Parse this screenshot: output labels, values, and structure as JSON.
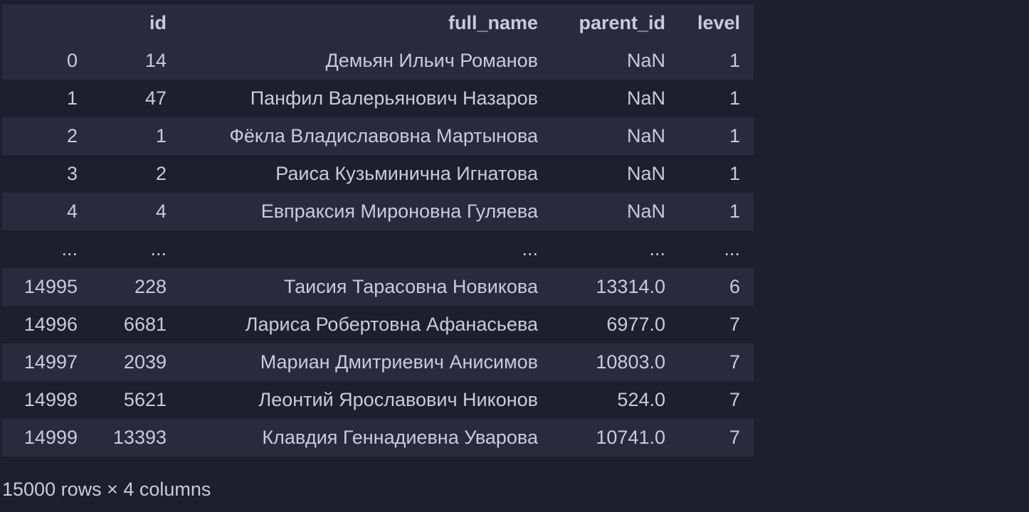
{
  "dataframe": {
    "columns": {
      "index": "",
      "id": "id",
      "full_name": "full_name",
      "parent_id": "parent_id",
      "level": "level"
    },
    "rows": [
      {
        "index": "0",
        "id": "14",
        "full_name": "Демьян Ильич Романов",
        "parent_id": "NaN",
        "level": "1"
      },
      {
        "index": "1",
        "id": "47",
        "full_name": "Панфил Валерьянович Назаров",
        "parent_id": "NaN",
        "level": "1"
      },
      {
        "index": "2",
        "id": "1",
        "full_name": "Фёкла Владиславовна Мартынова",
        "parent_id": "NaN",
        "level": "1"
      },
      {
        "index": "3",
        "id": "2",
        "full_name": "Раиса Кузьминична Игнатова",
        "parent_id": "NaN",
        "level": "1"
      },
      {
        "index": "4",
        "id": "4",
        "full_name": "Евпраксия Мироновна Гуляева",
        "parent_id": "NaN",
        "level": "1"
      },
      {
        "index": "...",
        "id": "...",
        "full_name": "...",
        "parent_id": "...",
        "level": "..."
      },
      {
        "index": "14995",
        "id": "228",
        "full_name": "Таисия Тарасовна Новикова",
        "parent_id": "13314.0",
        "level": "6"
      },
      {
        "index": "14996",
        "id": "6681",
        "full_name": "Лариса Робертовна Афанасьева",
        "parent_id": "6977.0",
        "level": "7"
      },
      {
        "index": "14997",
        "id": "2039",
        "full_name": "Мариан Дмитриевич Анисимов",
        "parent_id": "10803.0",
        "level": "7"
      },
      {
        "index": "14998",
        "id": "5621",
        "full_name": "Леонтий Ярославович Никонов",
        "parent_id": "524.0",
        "level": "7"
      },
      {
        "index": "14999",
        "id": "13393",
        "full_name": "Клавдия Геннадиевна Уварова",
        "parent_id": "10741.0",
        "level": "7"
      }
    ],
    "shape_text": "15000 rows × 4 columns"
  },
  "colors": {
    "background": "#1e1f2e",
    "stripe": "#292b3d",
    "text": "#c9cbd9"
  }
}
